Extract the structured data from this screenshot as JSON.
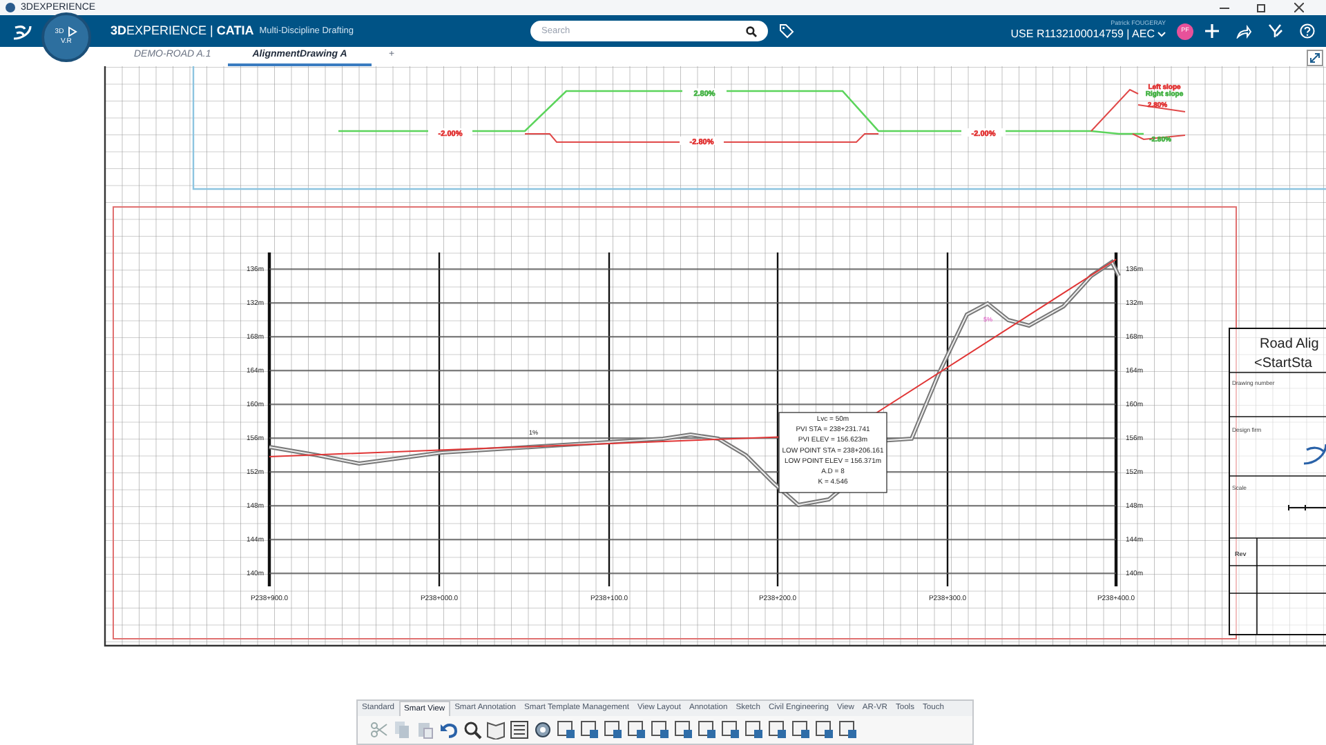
{
  "window": {
    "title": "3DEXPERIENCE"
  },
  "header": {
    "brand": "**3D**EXPERIENCE | **CATIA**",
    "app": "Multi-Discipline Drafting",
    "compass": [
      "3D",
      "V.R"
    ],
    "search": {
      "placeholder": "Search"
    },
    "user": "Patrick FOUGERAY",
    "credentials": "USE R1132100014759 | AEC",
    "avatar": "PF"
  },
  "tabs": [
    {
      "label": "DEMO-ROAD A.1",
      "selected": false
    },
    {
      "label": "AlignmentDrawing A",
      "selected": true
    },
    {
      "label": "+",
      "selected": false
    }
  ],
  "cross_section": {
    "labels": [
      {
        "text": "-2.00%",
        "color": "#e03030"
      },
      {
        "text": "2.80%",
        "color": "#40b040"
      },
      {
        "text": "-2.80%",
        "color": "#e03030"
      },
      {
        "text": "-2.00%",
        "color": "#e03030"
      },
      {
        "text": "Left slope",
        "color": "#e03030"
      },
      {
        "text": "Right slope",
        "color": "#40b040"
      },
      {
        "text": "2.80%",
        "color": "#e03030"
      },
      {
        "text": "-2.80%",
        "color": "#40b040"
      }
    ]
  },
  "profile": {
    "y_labels_left": [
      "136m",
      "132m",
      "168m",
      "164m",
      "160m",
      "156m",
      "152m",
      "148m",
      "144m",
      "140m"
    ],
    "y_labels_right": [
      "136m",
      "132m",
      "168m",
      "164m",
      "160m",
      "156m",
      "152m",
      "148m",
      "144m",
      "140m"
    ],
    "x_labels": [
      "P238+900.0",
      "P238+000.0",
      "P238+100.0",
      "P238+200.0",
      "P238+300.0",
      "P238+400.0"
    ],
    "grade_label": "1%",
    "marker_label": "5%",
    "curve_notes": [
      "Lvc = 50m",
      "PVI STA = 238+231.741",
      "PVI ELEV = 156.623m",
      "LOW POINT STA = 238+206.161",
      "LOW POINT ELEV = 156.371m",
      "A.D = 8",
      "K = 4.546"
    ]
  },
  "title_block": {
    "title": "Road Alig",
    "subtitle": "<StartSta",
    "fields": [
      "Drawing number",
      "Design firm",
      "Scale",
      "Rev"
    ]
  },
  "toolbar": {
    "tabs": [
      {
        "label": "Standard",
        "selected": false
      },
      {
        "label": "Smart View",
        "selected": true
      },
      {
        "label": "Smart Annotation",
        "selected": false
      },
      {
        "label": "Smart Template Management",
        "selected": false
      },
      {
        "label": "View Layout",
        "selected": false
      },
      {
        "label": "Annotation",
        "selected": false
      },
      {
        "label": "Sketch",
        "selected": false
      },
      {
        "label": "Civil Engineering",
        "selected": false
      },
      {
        "label": "View",
        "selected": false
      },
      {
        "label": "AR-VR",
        "selected": false
      },
      {
        "label": "Tools",
        "selected": false
      },
      {
        "label": "Touch",
        "selected": false
      }
    ]
  }
}
